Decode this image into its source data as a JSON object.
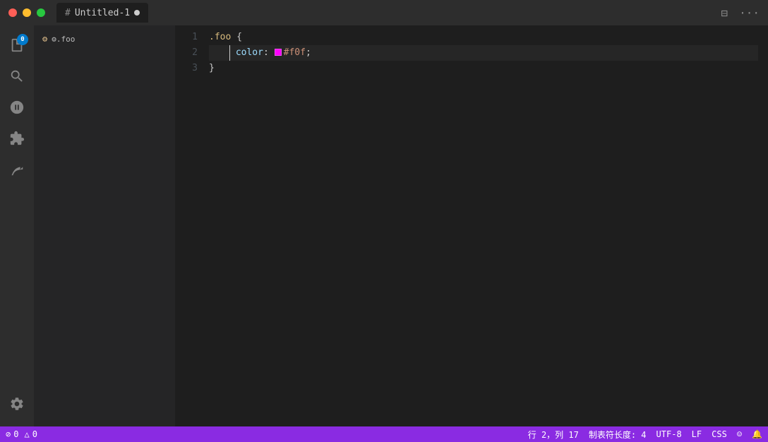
{
  "titlebar": {
    "tab_hash": "#",
    "tab_name": "Untitled-1",
    "traffic_lights": [
      "close",
      "minimize",
      "maximize"
    ]
  },
  "sidebar": {
    "file_icon": "🎯",
    "file_label": "⚙.foo"
  },
  "editor": {
    "lines": [
      {
        "number": "1",
        "content_type": "selector",
        "text": ".foo {"
      },
      {
        "number": "2",
        "content_type": "property",
        "indent": true,
        "property": "color",
        "colon": ":",
        "swatch_color": "#ff00ff",
        "value": "#f0f",
        "semicolon": ";"
      },
      {
        "number": "3",
        "content_type": "brace",
        "text": "}"
      }
    ]
  },
  "statusbar": {
    "errors": "0",
    "warnings": "0",
    "position": "行 2，列 17",
    "tab_size": "制表符长度: 4",
    "encoding": "UTF-8",
    "line_ending": "LF",
    "language": "CSS",
    "smiley": "☺",
    "bell": "🔔",
    "error_icon": "⊘",
    "warning_icon": "△"
  }
}
